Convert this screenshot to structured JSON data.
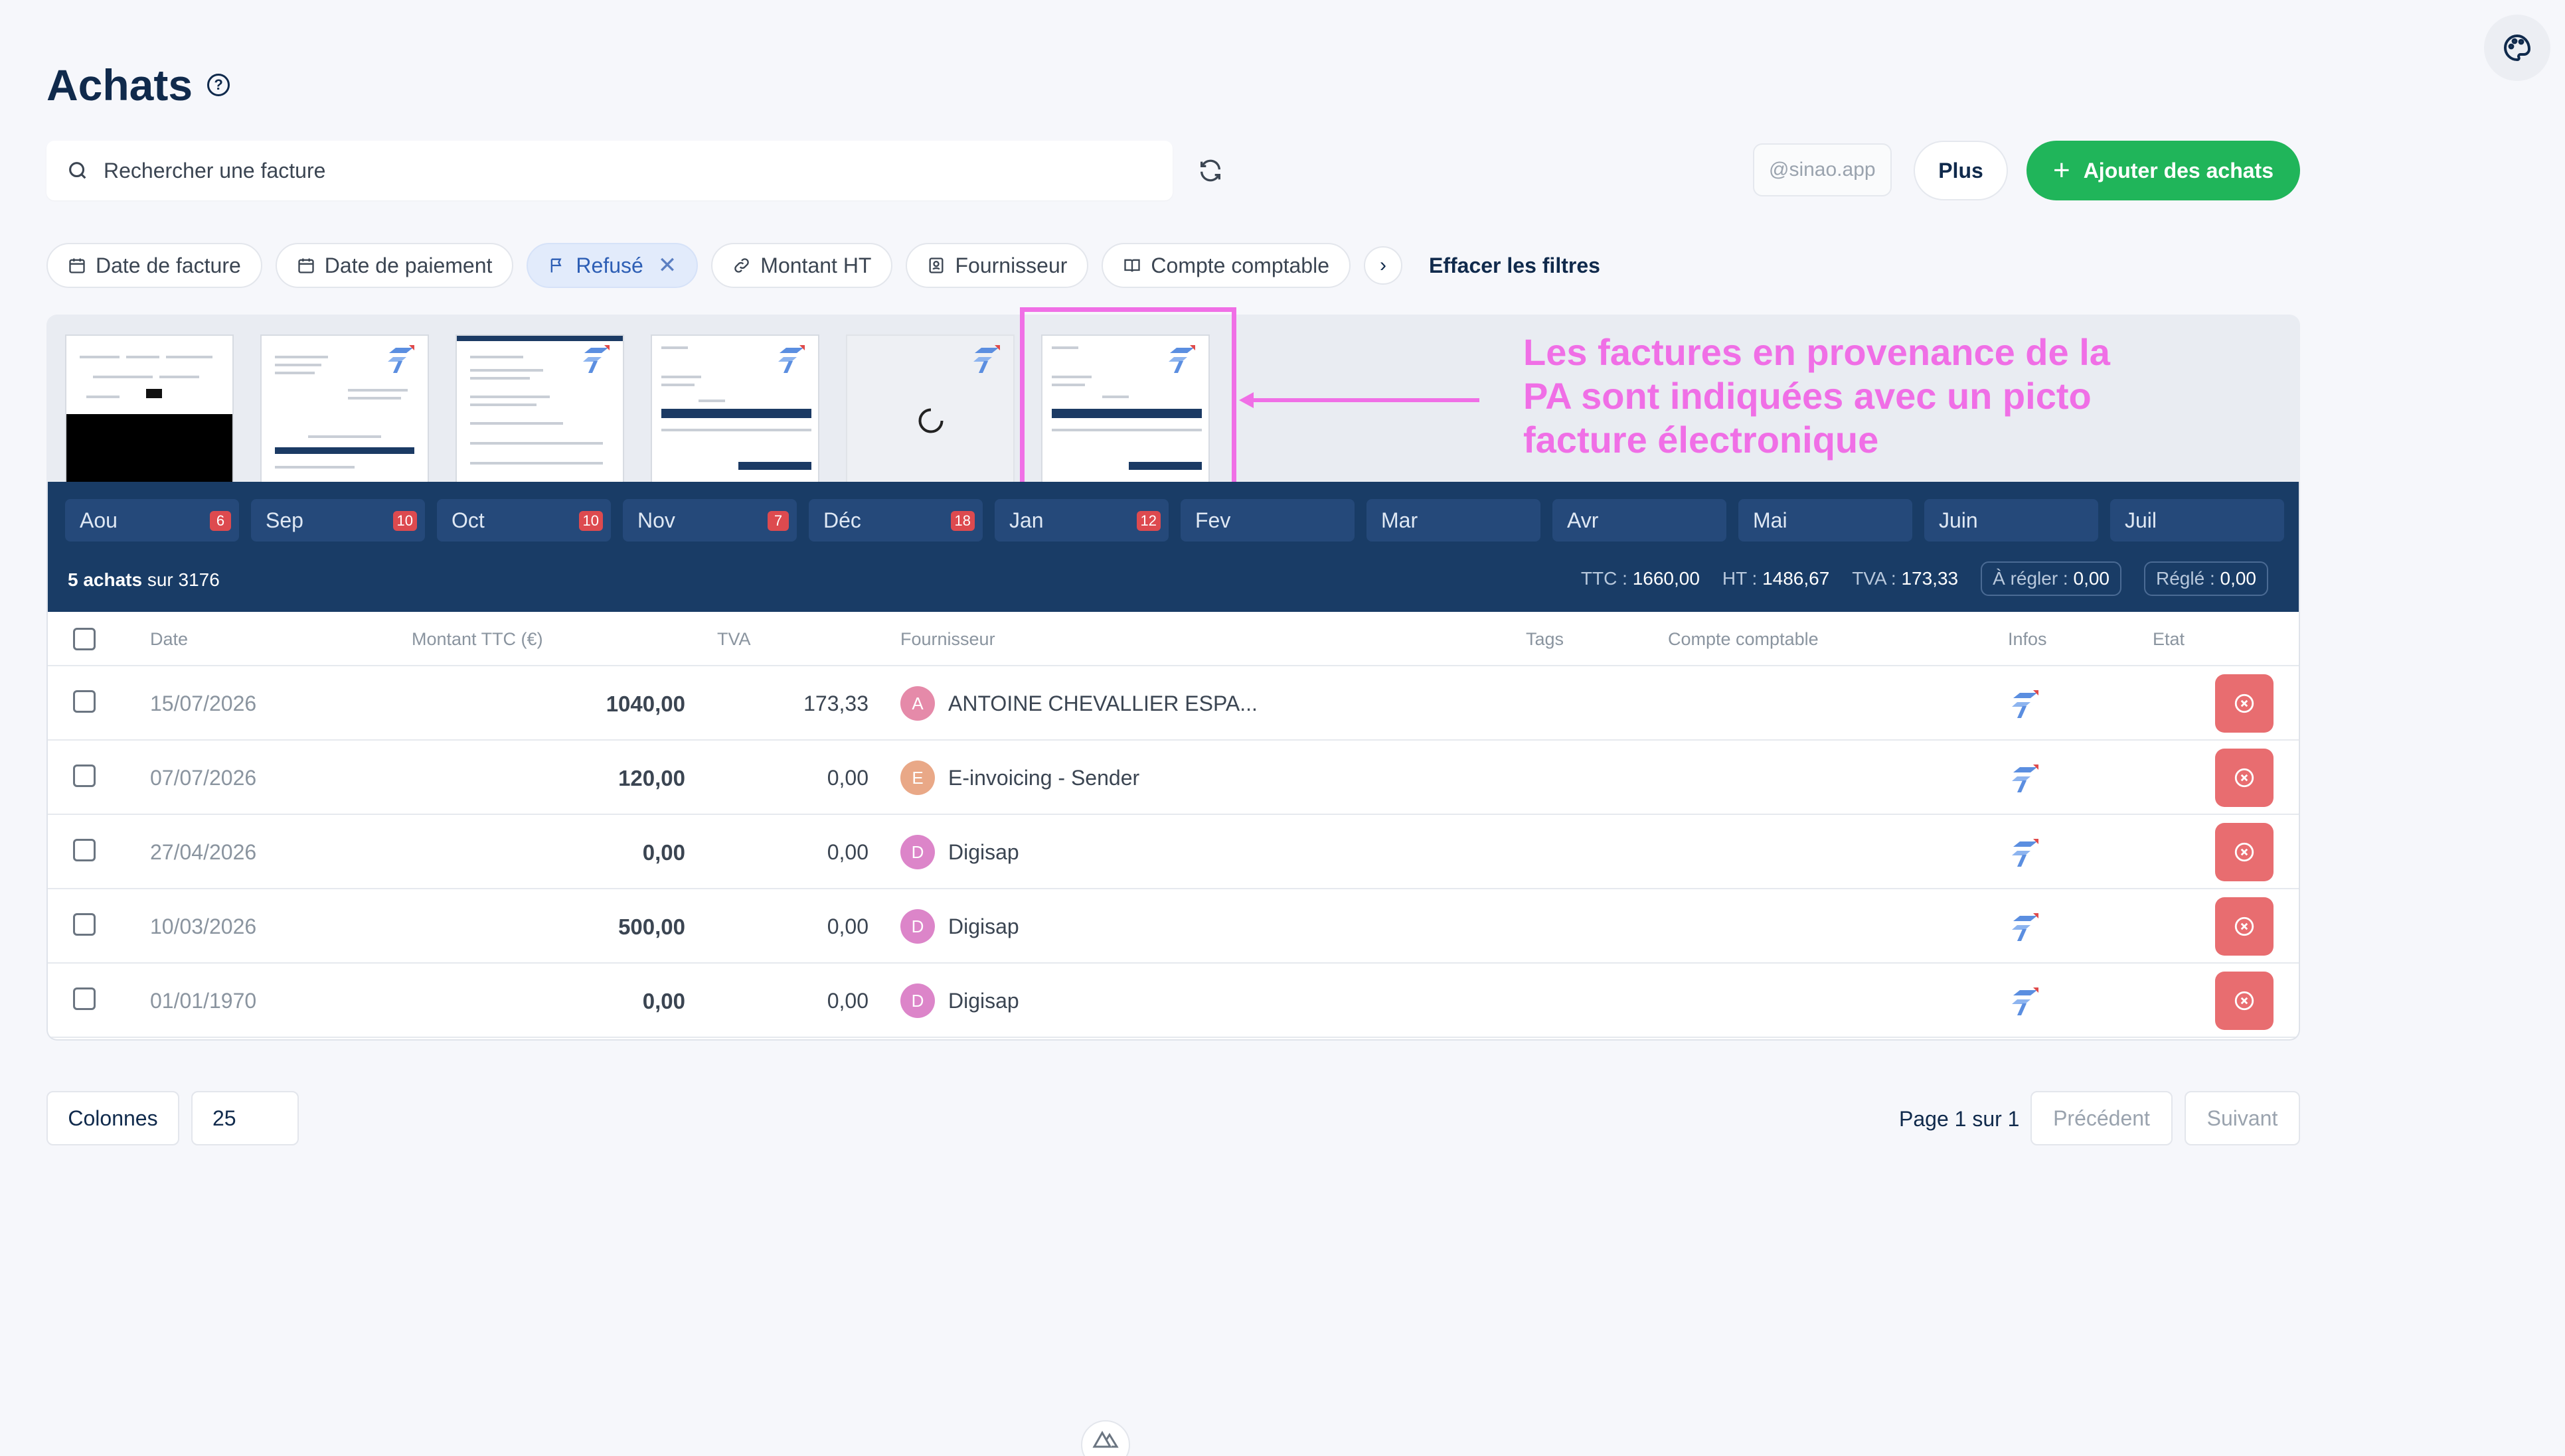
{
  "header": {
    "title": "Achats",
    "help_icon": "?"
  },
  "search": {
    "placeholder": "Rechercher une facture"
  },
  "actions": {
    "email": "@sinao.app",
    "more_label": "Plus",
    "add_label": "Ajouter des achats"
  },
  "filters": {
    "chips": [
      {
        "label": "Date de facture",
        "icon": "calendar-icon",
        "active": false
      },
      {
        "label": "Date de paiement",
        "icon": "calendar-icon",
        "active": false
      },
      {
        "label": "Refusé",
        "icon": "flag-icon",
        "active": true
      },
      {
        "label": "Montant HT",
        "icon": "link-icon",
        "active": false
      },
      {
        "label": "Fournisseur",
        "icon": "contact-icon",
        "active": false
      },
      {
        "label": "Compte comptable",
        "icon": "book-icon",
        "active": false
      }
    ],
    "clear_label": "Effacer les filtres"
  },
  "annotation": {
    "text": "Les factures en provenance de la PA sont indiquées avec un picto facture électronique"
  },
  "months": [
    {
      "label": "Aou",
      "count": "6"
    },
    {
      "label": "Sep",
      "count": "10"
    },
    {
      "label": "Oct",
      "count": "10"
    },
    {
      "label": "Nov",
      "count": "7"
    },
    {
      "label": "Déc",
      "count": "18"
    },
    {
      "label": "Jan",
      "count": "12"
    },
    {
      "label": "Fev",
      "count": ""
    },
    {
      "label": "Mar",
      "count": ""
    },
    {
      "label": "Avr",
      "count": ""
    },
    {
      "label": "Mai",
      "count": ""
    },
    {
      "label": "Juin",
      "count": ""
    },
    {
      "label": "Juil",
      "count": ""
    }
  ],
  "summary": {
    "count_bold": "5 achats",
    "count_rest": " sur 3176",
    "ttc_label": "TTC :",
    "ttc": "1660,00",
    "ht_label": "HT :",
    "ht": "1486,67",
    "tva_label": "TVA :",
    "tva": "173,33",
    "a_regler_label": "À régler :",
    "a_regler": "0,00",
    "regle_label": "Réglé :",
    "regle": "0,00"
  },
  "table": {
    "columns": [
      "Date",
      "Montant TTC (€)",
      "TVA",
      "Fournisseur",
      "Tags",
      "Compte comptable",
      "Infos",
      "Etat"
    ],
    "rows": [
      {
        "date": "15/07/2026",
        "ttc": "1040,00",
        "tva": "173,33",
        "initial": "A",
        "supplier": "ANTOINE CHEVALLIER ESPA...",
        "avatar_color": "#e58aa9"
      },
      {
        "date": "07/07/2026",
        "ttc": "120,00",
        "tva": "0,00",
        "initial": "E",
        "supplier": "E-invoicing - Sender",
        "avatar_color": "#e9a887"
      },
      {
        "date": "27/04/2026",
        "ttc": "0,00",
        "tva": "0,00",
        "initial": "D",
        "supplier": "Digisap",
        "avatar_color": "#dc85c9"
      },
      {
        "date": "10/03/2026",
        "ttc": "500,00",
        "tva": "0,00",
        "initial": "D",
        "supplier": "Digisap",
        "avatar_color": "#dc85c9"
      },
      {
        "date": "01/01/1970",
        "ttc": "0,00",
        "tva": "0,00",
        "initial": "D",
        "supplier": "Digisap",
        "avatar_color": "#dc85c9"
      }
    ]
  },
  "pagination": {
    "columns_label": "Colonnes",
    "page_size": "25",
    "page_info": "Page 1 sur 1",
    "prev_label": "Précédent",
    "next_label": "Suivant"
  },
  "colors": {
    "accent_green": "#20b55a",
    "navy": "#193c66",
    "annotation_pink": "#f06fe6",
    "refused_red": "#e86d70"
  }
}
